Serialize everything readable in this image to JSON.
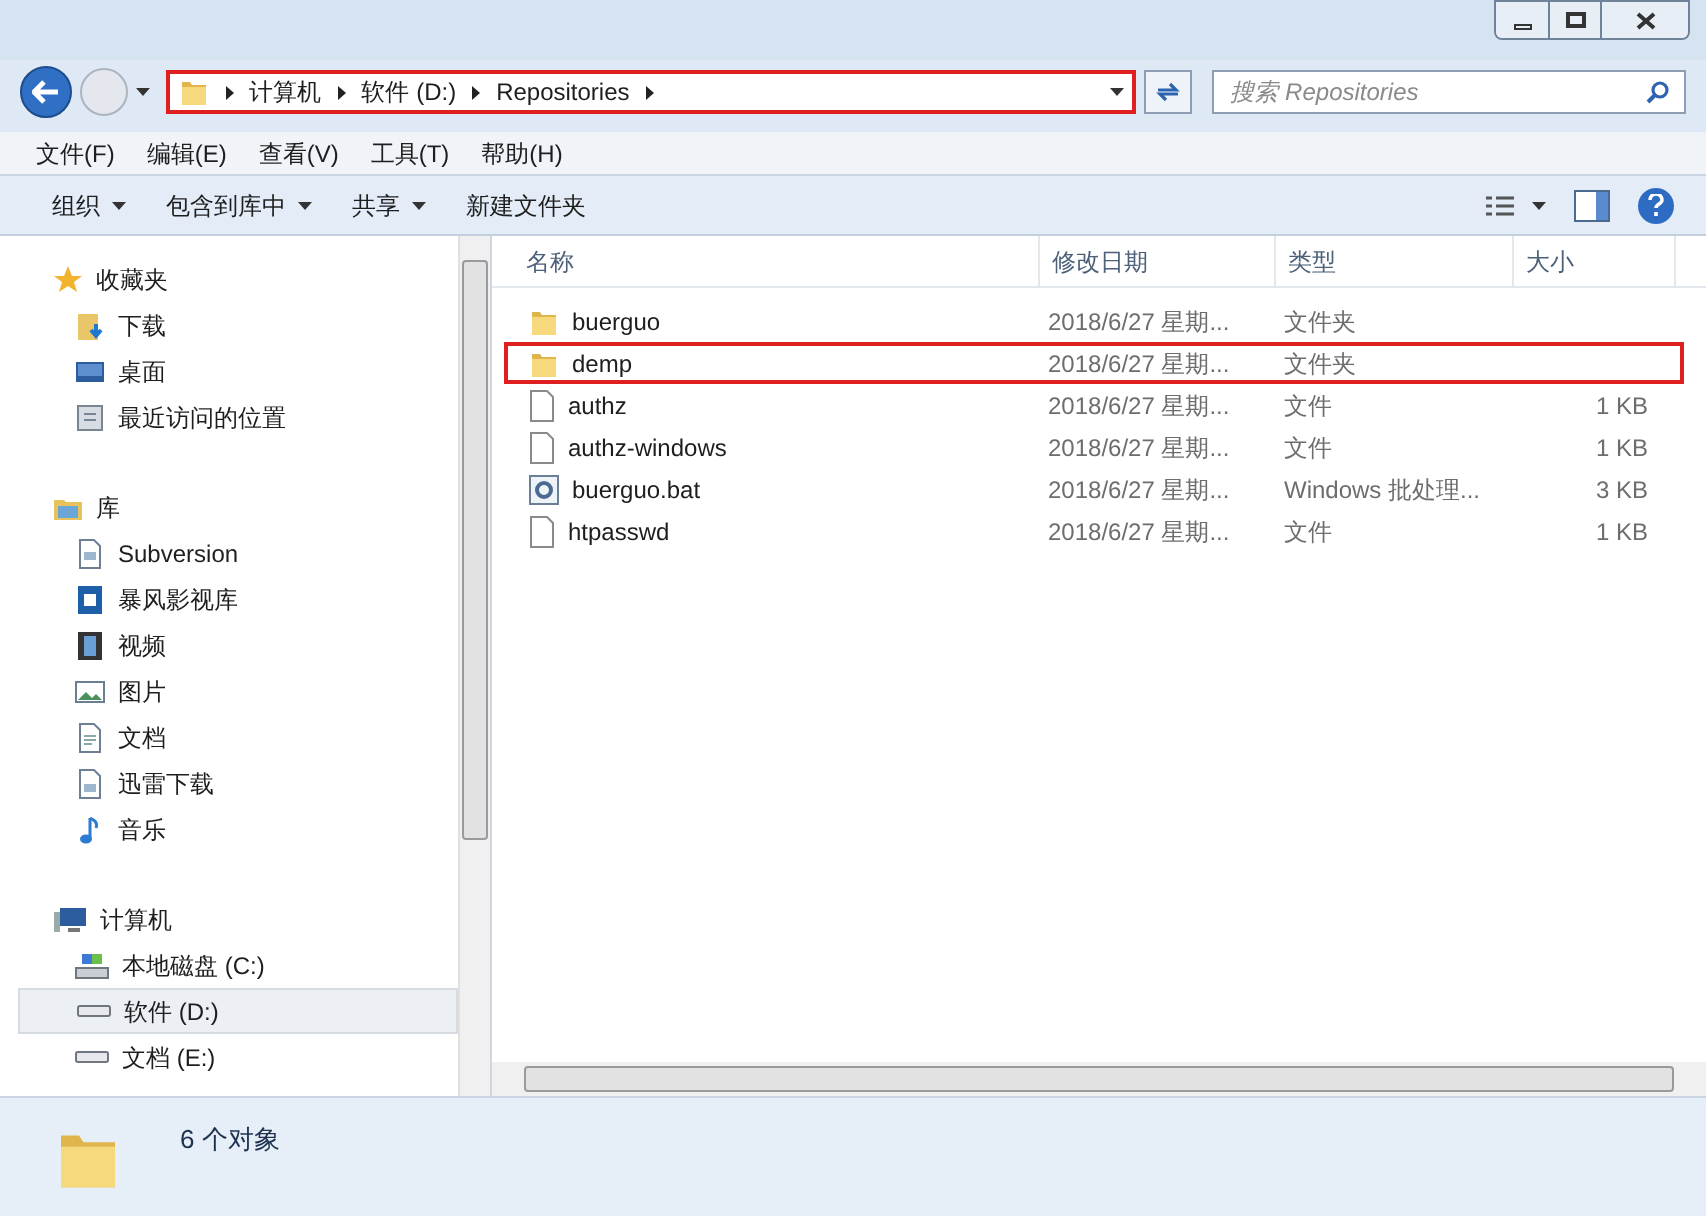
{
  "address_bar": {
    "highlighted": true,
    "crumbs": [
      "计算机",
      "软件 (D:)",
      "Repositories"
    ]
  },
  "search": {
    "placeholder": "搜索 Repositories"
  },
  "menu": [
    "文件(F)",
    "编辑(E)",
    "查看(V)",
    "工具(T)",
    "帮助(H)"
  ],
  "toolbar": [
    {
      "label": "组织",
      "dropdown": true
    },
    {
      "label": "包含到库中",
      "dropdown": true
    },
    {
      "label": "共享",
      "dropdown": true
    },
    {
      "label": "新建文件夹",
      "dropdown": false
    }
  ],
  "sidebar": [
    {
      "label": "收藏夹",
      "children": [
        {
          "label": "下载",
          "selected": false
        },
        {
          "label": "桌面",
          "selected": false
        },
        {
          "label": "最近访问的位置",
          "selected": false
        }
      ]
    },
    {
      "label": "库",
      "children": [
        {
          "label": "Subversion",
          "selected": false
        },
        {
          "label": "暴风影视库",
          "selected": false
        },
        {
          "label": "视频",
          "selected": false
        },
        {
          "label": "图片",
          "selected": false
        },
        {
          "label": "文档",
          "selected": false
        },
        {
          "label": "迅雷下载",
          "selected": false
        },
        {
          "label": "音乐",
          "selected": false
        }
      ]
    },
    {
      "label": "计算机",
      "children": [
        {
          "label": "本地磁盘 (C:)",
          "selected": false
        },
        {
          "label": "软件 (D:)",
          "selected": true
        },
        {
          "label": "文档 (E:)",
          "selected": false
        }
      ]
    }
  ],
  "columns": [
    "名称",
    "修改日期",
    "类型",
    "大小"
  ],
  "rows": [
    {
      "kind": "folder",
      "name": "buerguo",
      "date": "2018/6/27 星期...",
      "type": "文件夹",
      "highlighted": false
    },
    {
      "kind": "folder",
      "name": "demp",
      "date": "2018/6/27 星期...",
      "type": "文件夹",
      "highlighted": true
    },
    {
      "kind": "file",
      "name": "authz",
      "date": "2018/6/27 星期...",
      "type": "文件",
      "size": "1 KB",
      "highlighted": false
    },
    {
      "kind": "file",
      "name": "authz-windows",
      "date": "2018/6/27 星期...",
      "type": "文件",
      "size": "1 KB",
      "highlighted": false
    },
    {
      "kind": "script",
      "name": "buerguo.bat",
      "date": "2018/6/27 星期...",
      "type": "Windows 批处理...",
      "size": "3 KB",
      "highlighted": false
    },
    {
      "kind": "file",
      "name": "htpasswd",
      "date": "2018/6/27 星期...",
      "type": "文件",
      "size": "1 KB",
      "highlighted": false
    }
  ],
  "status": "6 个对象"
}
